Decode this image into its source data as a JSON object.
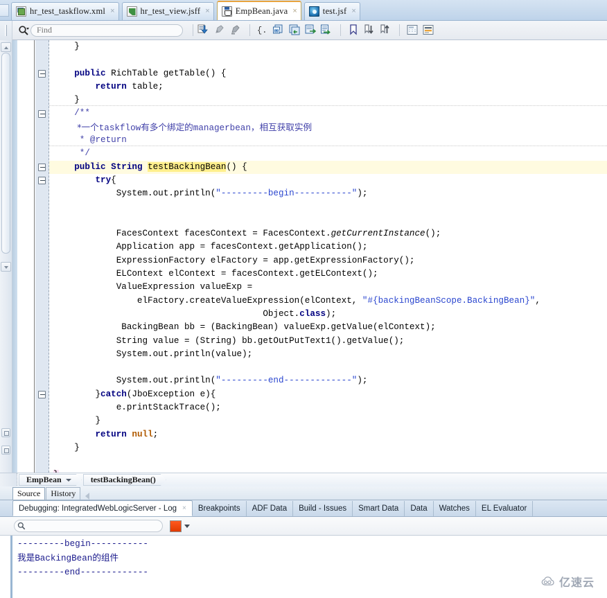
{
  "window": {
    "ide": "JDeveloper"
  },
  "editor_tabs": [
    {
      "label": "hr_test_taskflow.xml",
      "icon": "xml-file-icon",
      "active": false,
      "close": "×"
    },
    {
      "label": "hr_test_view.jsff",
      "icon": "jsff-file-icon",
      "active": false,
      "close": "×"
    },
    {
      "label": "EmpBean.java",
      "icon": "java-file-icon",
      "active": true,
      "close": "×"
    },
    {
      "label": "test.jsf",
      "icon": "jsf-file-icon",
      "active": false,
      "close": "×"
    }
  ],
  "toolbar": {
    "find_placeholder": "Find",
    "find_value": "",
    "search_icon": "search-icon",
    "icons": [
      "show-next-error-icon",
      "highlight-icon",
      "remove-highlight-icon",
      "code-block-icon",
      "refactor-rename-icon",
      "surround-with-icon",
      "export-icon",
      "code-assist-icon",
      "bookmark-icon",
      "next-bookmark-icon",
      "previous-bookmark-icon",
      "toggle-panel-icon",
      "toggle-status-icon"
    ]
  },
  "code": {
    "lines": [
      {
        "indent": 1,
        "fold": false,
        "hl": false,
        "tokens": [
          {
            "t": "}",
            "c": ""
          }
        ]
      },
      {
        "indent": 0,
        "fold": false,
        "hl": false,
        "tokens": []
      },
      {
        "indent": 1,
        "fold": true,
        "hl": false,
        "tokens": [
          {
            "t": "public",
            "c": "kw"
          },
          {
            "t": " RichTable getTable() {",
            "c": ""
          }
        ]
      },
      {
        "indent": 2,
        "fold": false,
        "hl": false,
        "tokens": [
          {
            "t": "return",
            "c": "kw"
          },
          {
            "t": " table;",
            "c": ""
          }
        ]
      },
      {
        "indent": 1,
        "fold": false,
        "hl": false,
        "tokens": [
          {
            "t": "}",
            "c": ""
          }
        ]
      },
      {
        "indent": 1,
        "fold": true,
        "hl": false,
        "tokens": [
          {
            "t": "/**",
            "c": "cmt"
          }
        ]
      },
      {
        "indent": 1,
        "fold": false,
        "hl": false,
        "tokens": [
          {
            "t": " *一个",
            "c": "cmt-zh"
          },
          {
            "t": "taskflow",
            "c": "cmt"
          },
          {
            "t": "有多个绑定的",
            "c": "cmt-zh"
          },
          {
            "t": "managerbean",
            "c": "cmt"
          },
          {
            "t": "，相互获取实例",
            "c": "cmt-zh"
          }
        ]
      },
      {
        "indent": 1,
        "fold": false,
        "hl": false,
        "tokens": [
          {
            "t": " * @return",
            "c": "cmt"
          }
        ]
      },
      {
        "indent": 1,
        "fold": false,
        "hl": false,
        "tokens": [
          {
            "t": " */",
            "c": "cmt"
          }
        ]
      },
      {
        "indent": 1,
        "fold": true,
        "hl": true,
        "tokens": [
          {
            "t": "public",
            "c": "kw"
          },
          {
            "t": " ",
            "c": ""
          },
          {
            "t": "String",
            "c": "kw"
          },
          {
            "t": " ",
            "c": ""
          },
          {
            "t": "testBackingBean",
            "c": "hlmark"
          },
          {
            "t": "() {",
            "c": ""
          }
        ]
      },
      {
        "indent": 2,
        "fold": true,
        "hl": false,
        "tokens": [
          {
            "t": "try",
            "c": "kw"
          },
          {
            "t": "{",
            "c": ""
          }
        ]
      },
      {
        "indent": 3,
        "fold": false,
        "hl": false,
        "tokens": [
          {
            "t": "System.out.println(",
            "c": ""
          },
          {
            "t": "\"---------begin-----------\"",
            "c": "str"
          },
          {
            "t": ");",
            "c": ""
          }
        ]
      },
      {
        "indent": 0,
        "fold": false,
        "hl": false,
        "tokens": []
      },
      {
        "indent": 0,
        "fold": false,
        "hl": false,
        "tokens": []
      },
      {
        "indent": 3,
        "fold": false,
        "hl": false,
        "tokens": [
          {
            "t": "FacesContext facesContext = FacesContext.",
            "c": ""
          },
          {
            "t": "getCurrentInstance",
            "c": "ital"
          },
          {
            "t": "();",
            "c": ""
          }
        ]
      },
      {
        "indent": 3,
        "fold": false,
        "hl": false,
        "tokens": [
          {
            "t": "Application app = facesContext.getApplication();",
            "c": ""
          }
        ]
      },
      {
        "indent": 3,
        "fold": false,
        "hl": false,
        "tokens": [
          {
            "t": "ExpressionFactory elFactory = app.getExpressionFactory();",
            "c": ""
          }
        ]
      },
      {
        "indent": 3,
        "fold": false,
        "hl": false,
        "tokens": [
          {
            "t": "ELContext elContext = facesContext.getELContext();",
            "c": ""
          }
        ]
      },
      {
        "indent": 3,
        "fold": false,
        "hl": false,
        "tokens": [
          {
            "t": "ValueExpression valueExp =",
            "c": ""
          }
        ]
      },
      {
        "indent": 4,
        "fold": false,
        "hl": false,
        "tokens": [
          {
            "t": "elFactory.createValueExpression(elContext, ",
            "c": ""
          },
          {
            "t": "\"#{backingBeanScope.BackingBean}\"",
            "c": "str"
          },
          {
            "t": ",",
            "c": ""
          }
        ]
      },
      {
        "indent": 10,
        "fold": false,
        "hl": false,
        "tokens": [
          {
            "t": "Object.",
            "c": ""
          },
          {
            "t": "class",
            "c": "kw"
          },
          {
            "t": ");",
            "c": ""
          }
        ]
      },
      {
        "indent": 3,
        "fold": false,
        "hl": false,
        "tokens": [
          {
            "t": " BackingBean bb = (BackingBean) valueExp.getValue(elContext);",
            "c": ""
          }
        ]
      },
      {
        "indent": 3,
        "fold": false,
        "hl": false,
        "tokens": [
          {
            "t": "String value = (String) bb.getOutPutText1().getValue();",
            "c": ""
          }
        ]
      },
      {
        "indent": 3,
        "fold": false,
        "hl": false,
        "tokens": [
          {
            "t": "System.out.println(value);",
            "c": ""
          }
        ]
      },
      {
        "indent": 0,
        "fold": false,
        "hl": false,
        "tokens": []
      },
      {
        "indent": 3,
        "fold": false,
        "hl": false,
        "tokens": [
          {
            "t": "System.out.println(",
            "c": ""
          },
          {
            "t": "\"---------end-------------\"",
            "c": "str"
          },
          {
            "t": ");",
            "c": ""
          }
        ]
      },
      {
        "indent": 2,
        "fold": true,
        "hl": false,
        "tokens": [
          {
            "t": "}",
            "c": ""
          },
          {
            "t": "catch",
            "c": "kw"
          },
          {
            "t": "(JboException e){",
            "c": ""
          }
        ]
      },
      {
        "indent": 3,
        "fold": false,
        "hl": false,
        "tokens": [
          {
            "t": "e.printStackTrace();",
            "c": ""
          }
        ]
      },
      {
        "indent": 2,
        "fold": false,
        "hl": false,
        "tokens": [
          {
            "t": "}",
            "c": ""
          }
        ]
      },
      {
        "indent": 2,
        "fold": false,
        "hl": false,
        "tokens": [
          {
            "t": "return",
            "c": "kw"
          },
          {
            "t": " ",
            "c": ""
          },
          {
            "t": "null",
            "c": "lit"
          },
          {
            "t": ";",
            "c": ""
          }
        ]
      },
      {
        "indent": 1,
        "fold": false,
        "hl": false,
        "tokens": [
          {
            "t": "}",
            "c": ""
          }
        ]
      },
      {
        "indent": 0,
        "fold": false,
        "hl": false,
        "tokens": []
      },
      {
        "indent": 0,
        "fold": false,
        "hl": false,
        "tokens": [
          {
            "t": "}",
            "c": "bracehl"
          }
        ]
      }
    ]
  },
  "breadcrumb": {
    "class_label": "EmpBean",
    "method_label": "testBackingBean()"
  },
  "source_tabs": [
    {
      "label": "Source",
      "active": true
    },
    {
      "label": "History",
      "active": false
    }
  ],
  "log_tabs": [
    {
      "label": "Debugging: IntegratedWebLogicServer - Log",
      "active": true,
      "close": "×"
    },
    {
      "label": "Breakpoints",
      "active": false
    },
    {
      "label": "ADF Data",
      "active": false
    },
    {
      "label": "Build - Issues",
      "active": false
    },
    {
      "label": "Smart Data",
      "active": false
    },
    {
      "label": "Data",
      "active": false
    },
    {
      "label": "Watches",
      "active": false
    },
    {
      "label": "EL Evaluator",
      "active": false
    }
  ],
  "log_search": {
    "placeholder": "",
    "value": "",
    "icon": "search-icon",
    "color_swatch": "#ef4400",
    "dropdown_icon": "chevron-down-icon"
  },
  "log_output": {
    "lines": [
      {
        "segments": [
          {
            "t": "---------begin-----------",
            "zh": false
          }
        ]
      },
      {
        "segments": [
          {
            "t": "我是",
            "zh": true
          },
          {
            "t": "BackingBean",
            "zh": false
          },
          {
            "t": "的组件",
            "zh": true
          }
        ]
      },
      {
        "segments": [
          {
            "t": "---------end-------------",
            "zh": false
          }
        ]
      }
    ]
  },
  "watermark": {
    "text": "亿速云",
    "icon": "cloud-icon"
  },
  "colors": {
    "keyword": "#000080",
    "string": "#2a46cf",
    "comment": "#3f3fa8",
    "literal": "#b05a00",
    "highlight_line": "#fffbe0",
    "active_tab_border": "#e8a33d",
    "log_text": "#1a1a8c"
  }
}
